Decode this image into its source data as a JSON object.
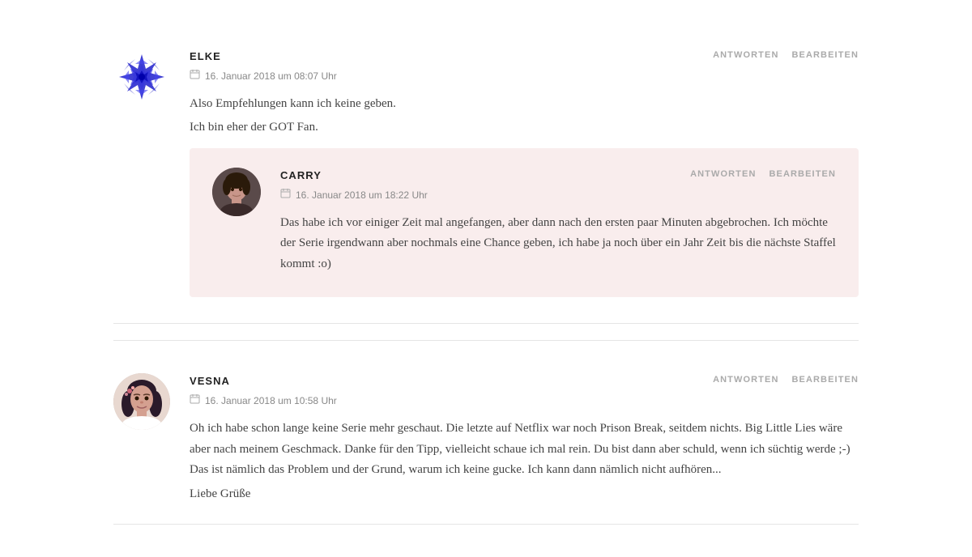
{
  "comments": [
    {
      "id": "elke",
      "author": "ELKE",
      "date": "16. Januar 2018 um 08:07 Uhr",
      "action_reply": "ANTWORTEN",
      "action_edit": "BEARBEITEN",
      "text_lines": [
        "Also Empfehlungen kann ich keine geben.",
        "Ich bin eher der GOT Fan."
      ],
      "nested": {
        "id": "carry",
        "author": "CARRY",
        "date": "16. Januar 2018 um 18:22 Uhr",
        "action_reply": "ANTWORTEN",
        "action_edit": "BEARBEITEN",
        "text": "Das habe ich vor einiger Zeit mal angefangen, aber dann nach den ersten paar Minuten abgebrochen. Ich möchte der Serie irgendwann aber nochmals eine Chance geben, ich habe ja noch über ein Jahr Zeit bis die nächste Staffel kommt :o)"
      }
    },
    {
      "id": "vesna",
      "author": "VESNA",
      "date": "16. Januar 2018 um 10:58 Uhr",
      "action_reply": "ANTWORTEN",
      "action_edit": "BEARBEITEN",
      "text": "Oh ich habe schon lange keine Serie mehr geschaut. Die letzte auf Netflix war noch Prison Break, seitdem nichts. Big Little Lies wäre aber nach meinem Geschmack. Danke für den Tipp, vielleicht schaue ich mal rein. Du bist dann aber schuld, wenn ich süchtig werde ;-) Das ist nämlich das Problem und der Grund, warum ich keine gucke. Ich kann dann nämlich nicht aufhören...",
      "text2": "Liebe Grüße"
    }
  ],
  "icons": {
    "calendar": "📅"
  }
}
